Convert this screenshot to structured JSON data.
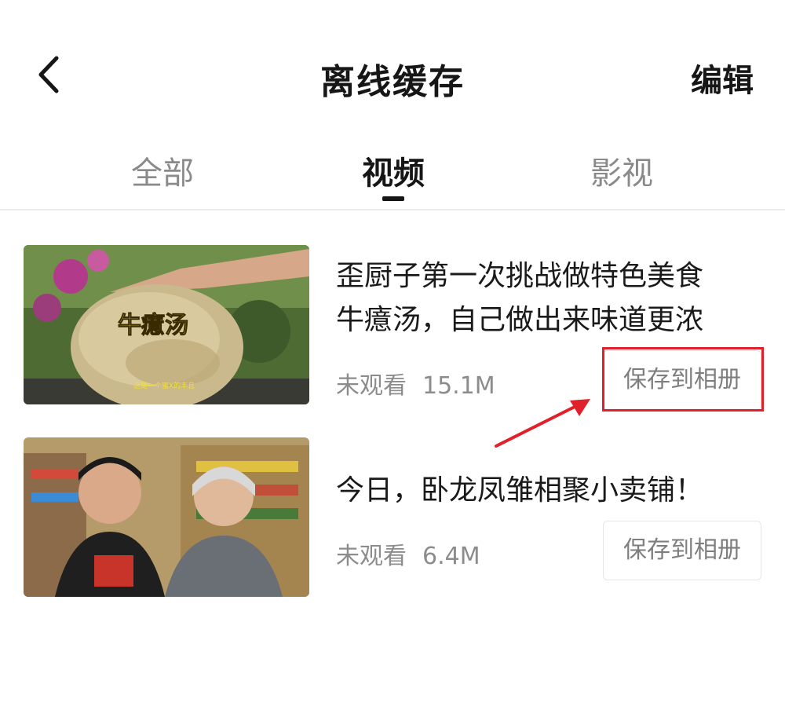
{
  "header": {
    "title": "离线缓存",
    "edit_label": "编辑"
  },
  "tabs": [
    {
      "label": "全部",
      "active": false
    },
    {
      "label": "视频",
      "active": true
    },
    {
      "label": "影视",
      "active": false
    }
  ],
  "videos": [
    {
      "title_line1": "歪厨子第一次挑战做特色美食",
      "title_line2": "牛癔汤，自己做出来味道更浓",
      "status": "未观看",
      "size": "15.1M",
      "save_label": "保存到相册",
      "thumb_caption": "牛癔汤",
      "thumb_subtitle": "这是一个蜜X的丰且"
    },
    {
      "title_line1": "今日，卧龙凤雏相聚小卖铺！",
      "status": "未观看",
      "size": "6.4M",
      "save_label": "保存到相册"
    }
  ],
  "colors": {
    "annotation": "#e0202a",
    "muted_text": "#8c8c8c"
  }
}
